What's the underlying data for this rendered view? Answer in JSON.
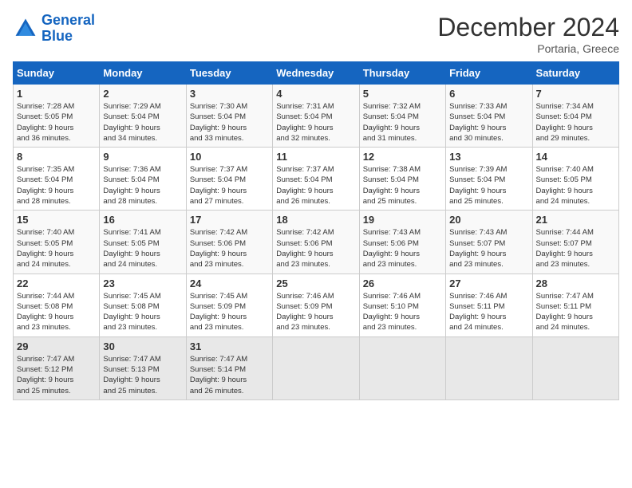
{
  "header": {
    "logo_general": "General",
    "logo_blue": "Blue",
    "title": "December 2024",
    "subtitle": "Portaria, Greece"
  },
  "columns": [
    "Sunday",
    "Monday",
    "Tuesday",
    "Wednesday",
    "Thursday",
    "Friday",
    "Saturday"
  ],
  "weeks": [
    [
      {
        "day": "1",
        "info": "Sunrise: 7:28 AM\nSunset: 5:05 PM\nDaylight: 9 hours\nand 36 minutes."
      },
      {
        "day": "2",
        "info": "Sunrise: 7:29 AM\nSunset: 5:04 PM\nDaylight: 9 hours\nand 34 minutes."
      },
      {
        "day": "3",
        "info": "Sunrise: 7:30 AM\nSunset: 5:04 PM\nDaylight: 9 hours\nand 33 minutes."
      },
      {
        "day": "4",
        "info": "Sunrise: 7:31 AM\nSunset: 5:04 PM\nDaylight: 9 hours\nand 32 minutes."
      },
      {
        "day": "5",
        "info": "Sunrise: 7:32 AM\nSunset: 5:04 PM\nDaylight: 9 hours\nand 31 minutes."
      },
      {
        "day": "6",
        "info": "Sunrise: 7:33 AM\nSunset: 5:04 PM\nDaylight: 9 hours\nand 30 minutes."
      },
      {
        "day": "7",
        "info": "Sunrise: 7:34 AM\nSunset: 5:04 PM\nDaylight: 9 hours\nand 29 minutes."
      }
    ],
    [
      {
        "day": "8",
        "info": "Sunrise: 7:35 AM\nSunset: 5:04 PM\nDaylight: 9 hours\nand 28 minutes."
      },
      {
        "day": "9",
        "info": "Sunrise: 7:36 AM\nSunset: 5:04 PM\nDaylight: 9 hours\nand 28 minutes."
      },
      {
        "day": "10",
        "info": "Sunrise: 7:37 AM\nSunset: 5:04 PM\nDaylight: 9 hours\nand 27 minutes."
      },
      {
        "day": "11",
        "info": "Sunrise: 7:37 AM\nSunset: 5:04 PM\nDaylight: 9 hours\nand 26 minutes."
      },
      {
        "day": "12",
        "info": "Sunrise: 7:38 AM\nSunset: 5:04 PM\nDaylight: 9 hours\nand 25 minutes."
      },
      {
        "day": "13",
        "info": "Sunrise: 7:39 AM\nSunset: 5:04 PM\nDaylight: 9 hours\nand 25 minutes."
      },
      {
        "day": "14",
        "info": "Sunrise: 7:40 AM\nSunset: 5:05 PM\nDaylight: 9 hours\nand 24 minutes."
      }
    ],
    [
      {
        "day": "15",
        "info": "Sunrise: 7:40 AM\nSunset: 5:05 PM\nDaylight: 9 hours\nand 24 minutes."
      },
      {
        "day": "16",
        "info": "Sunrise: 7:41 AM\nSunset: 5:05 PM\nDaylight: 9 hours\nand 24 minutes."
      },
      {
        "day": "17",
        "info": "Sunrise: 7:42 AM\nSunset: 5:06 PM\nDaylight: 9 hours\nand 23 minutes."
      },
      {
        "day": "18",
        "info": "Sunrise: 7:42 AM\nSunset: 5:06 PM\nDaylight: 9 hours\nand 23 minutes."
      },
      {
        "day": "19",
        "info": "Sunrise: 7:43 AM\nSunset: 5:06 PM\nDaylight: 9 hours\nand 23 minutes."
      },
      {
        "day": "20",
        "info": "Sunrise: 7:43 AM\nSunset: 5:07 PM\nDaylight: 9 hours\nand 23 minutes."
      },
      {
        "day": "21",
        "info": "Sunrise: 7:44 AM\nSunset: 5:07 PM\nDaylight: 9 hours\nand 23 minutes."
      }
    ],
    [
      {
        "day": "22",
        "info": "Sunrise: 7:44 AM\nSunset: 5:08 PM\nDaylight: 9 hours\nand 23 minutes."
      },
      {
        "day": "23",
        "info": "Sunrise: 7:45 AM\nSunset: 5:08 PM\nDaylight: 9 hours\nand 23 minutes."
      },
      {
        "day": "24",
        "info": "Sunrise: 7:45 AM\nSunset: 5:09 PM\nDaylight: 9 hours\nand 23 minutes."
      },
      {
        "day": "25",
        "info": "Sunrise: 7:46 AM\nSunset: 5:09 PM\nDaylight: 9 hours\nand 23 minutes."
      },
      {
        "day": "26",
        "info": "Sunrise: 7:46 AM\nSunset: 5:10 PM\nDaylight: 9 hours\nand 23 minutes."
      },
      {
        "day": "27",
        "info": "Sunrise: 7:46 AM\nSunset: 5:11 PM\nDaylight: 9 hours\nand 24 minutes."
      },
      {
        "day": "28",
        "info": "Sunrise: 7:47 AM\nSunset: 5:11 PM\nDaylight: 9 hours\nand 24 minutes."
      }
    ],
    [
      {
        "day": "29",
        "info": "Sunrise: 7:47 AM\nSunset: 5:12 PM\nDaylight: 9 hours\nand 25 minutes."
      },
      {
        "day": "30",
        "info": "Sunrise: 7:47 AM\nSunset: 5:13 PM\nDaylight: 9 hours\nand 25 minutes."
      },
      {
        "day": "31",
        "info": "Sunrise: 7:47 AM\nSunset: 5:14 PM\nDaylight: 9 hours\nand 26 minutes."
      },
      null,
      null,
      null,
      null
    ]
  ]
}
